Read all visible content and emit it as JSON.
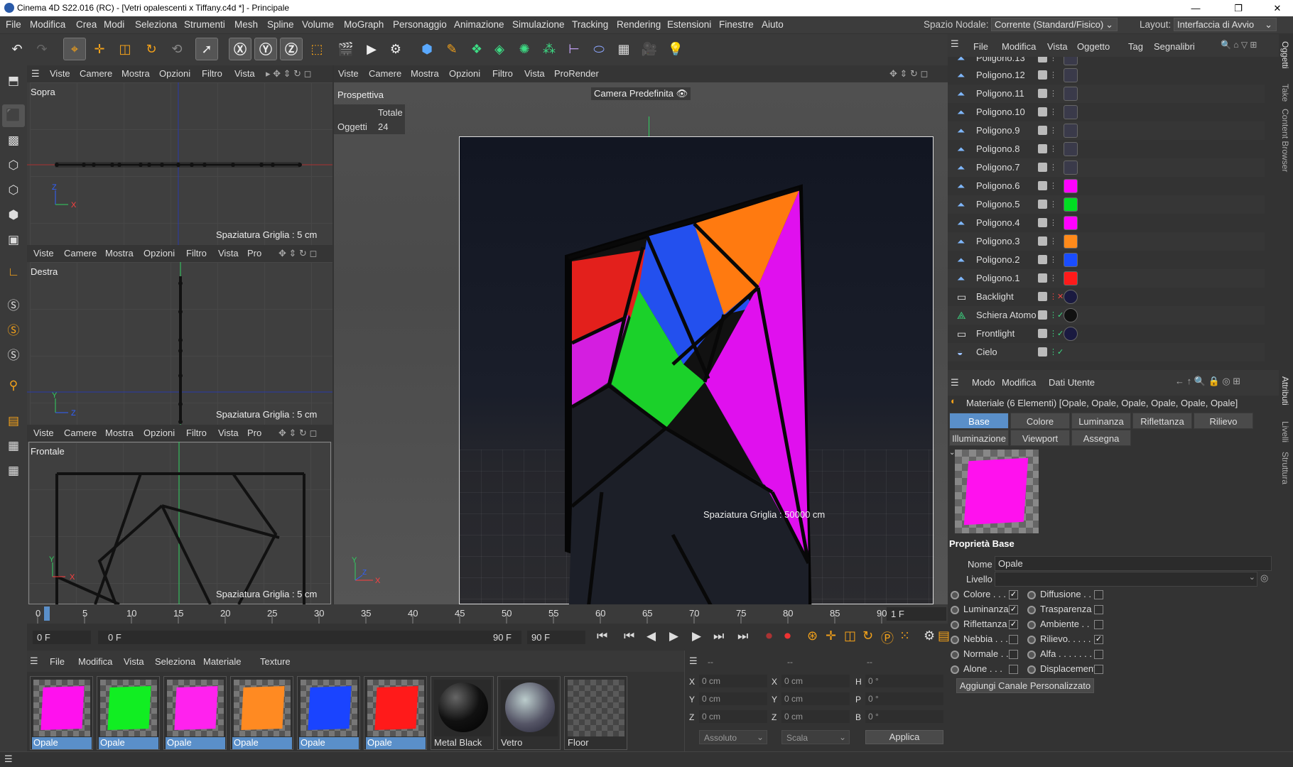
{
  "window": {
    "title": "Cinema 4D S22.016 (RC) - [Vetri opalescenti x Tiffany.c4d *] - Principale",
    "minimize": "—",
    "restore": "❐",
    "close": "✕"
  },
  "menu": [
    "File",
    "Modifica",
    "Crea",
    "Modi",
    "Seleziona",
    "Strumenti",
    "Mesh",
    "Spline",
    "Volume",
    "MoGraph",
    "Personaggio",
    "Animazione",
    "Simulazione",
    "Tracking",
    "Rendering",
    "Estensioni",
    "Finestre",
    "Aiuto"
  ],
  "spazio_nodale": {
    "label": "Spazio Nodale:",
    "value": "Corrente (Standard/Fisico)"
  },
  "layout": {
    "label": "Layout:",
    "value": "Interfaccia di Avvio"
  },
  "side_tabs": [
    "Oggetti",
    "Take",
    "Content Browser"
  ],
  "side_tabs2": [
    "Attributi",
    "Livelli",
    "Struttura"
  ],
  "viewport_menu": [
    "Viste",
    "Camere",
    "Mostra",
    "Opzioni",
    "Filtro",
    "Vista"
  ],
  "viewport_menu_short": [
    "Viste",
    "Camere",
    "Mostra",
    "Opzioni",
    "Filtro",
    "Vista",
    "Pro"
  ],
  "main_vp_menu": [
    "Viste",
    "Camere",
    "Mostra",
    "Opzioni",
    "Filtro",
    "Vista",
    "ProRender"
  ],
  "views": {
    "top": "Sopra",
    "right": "Destra",
    "front": "Frontale",
    "persp": "Prospettiva"
  },
  "grid_spacing": "Spaziatura Griglia : 5 cm",
  "grid_spacing_main": "Spaziatura Griglia : 50000 cm",
  "camera": "Camera Predefinita",
  "stats": {
    "header": "Totale",
    "label": "Oggetti",
    "value": "24"
  },
  "obj_menu": [
    "File",
    "Modifica",
    "Vista",
    "Oggetto",
    "Tag",
    "Segnalibri"
  ],
  "objects": [
    {
      "name": "Poligono.13",
      "tag": "#3a3a4a"
    },
    {
      "name": "Poligono.12",
      "tag": "#3a3a4a"
    },
    {
      "name": "Poligono.11",
      "tag": "#3a3a4a"
    },
    {
      "name": "Poligono.10",
      "tag": "#3a3a4a"
    },
    {
      "name": "Poligono.9",
      "tag": "#3a3a4a"
    },
    {
      "name": "Poligono.8",
      "tag": "#3a3a4a"
    },
    {
      "name": "Poligono.7",
      "tag": "#3a3a4a"
    },
    {
      "name": "Poligono.6",
      "tag": "#ff00ff"
    },
    {
      "name": "Poligono.5",
      "tag": "#00dd22"
    },
    {
      "name": "Poligono.4",
      "tag": "#ff00ff"
    },
    {
      "name": "Poligono.3",
      "tag": "#ff8a1a"
    },
    {
      "name": "Poligono.2",
      "tag": "#1a4dff"
    },
    {
      "name": "Poligono.1",
      "tag": "#ff1a1a"
    },
    {
      "name": "Backlight",
      "tag": "#1a1a40"
    },
    {
      "name": "Schiera Atomo",
      "tag": "#111111"
    },
    {
      "name": "Frontlight",
      "tag": "#1a1a40"
    },
    {
      "name": "Cielo",
      "tag": ""
    }
  ],
  "attr_menu": [
    "Modo",
    "Modifica",
    "Dati Utente"
  ],
  "attr_title": "Materiale (6 Elementi) [Opale, Opale, Opale, Opale, Opale, Opale]",
  "attr_tabs": [
    "Base",
    "Colore",
    "Luminanza",
    "Riflettanza",
    "Rilievo"
  ],
  "attr_tabs2": [
    "Illuminazione",
    "Viewport",
    "Assegna"
  ],
  "props_title": "Proprietà Base",
  "nome": {
    "label": "Nome",
    "value": "Opale"
  },
  "livello": {
    "label": "Livello",
    "value": ""
  },
  "channels_left": [
    {
      "label": "Colore . . .",
      "checked": true
    },
    {
      "label": "Luminanza",
      "checked": true
    },
    {
      "label": "Riflettanza",
      "checked": true
    },
    {
      "label": "Nebbia . . .",
      "checked": false
    },
    {
      "label": "Normale . .",
      "checked": false
    },
    {
      "label": "Alone . . .",
      "checked": false
    }
  ],
  "channels_right": [
    {
      "label": "Diffusione . .",
      "checked": false
    },
    {
      "label": "Trasparenza",
      "checked": false
    },
    {
      "label": "Ambiente . .",
      "checked": false
    },
    {
      "label": "Rilievo. . . . .",
      "checked": true
    },
    {
      "label": "Alfa . . . . . . .",
      "checked": false
    },
    {
      "label": "Displacement",
      "checked": false
    }
  ],
  "add_channel": "Aggiungi Canale Personalizzato",
  "timeline": {
    "ticks": [
      "0",
      "5",
      "10",
      "15",
      "20",
      "25",
      "30",
      "35",
      "40",
      "45",
      "50",
      "55",
      "60",
      "65",
      "70",
      "75",
      "80",
      "85",
      "90"
    ],
    "frame": "1 F",
    "start": "0 F",
    "cur": "0 F",
    "end1": "90 F",
    "end2": "90 F"
  },
  "mat_menu": [
    "File",
    "Modifica",
    "Vista",
    "Seleziona",
    "Materiale",
    "Texture"
  ],
  "materials": [
    {
      "name": "Opale",
      "color": "#ff11ee",
      "sel": true
    },
    {
      "name": "Opale",
      "color": "#11ee22",
      "sel": true
    },
    {
      "name": "Opale",
      "color": "#ff22ee",
      "sel": true
    },
    {
      "name": "Opale",
      "color": "#ff8a22",
      "sel": true
    },
    {
      "name": "Opale",
      "color": "#1a44ff",
      "sel": true
    },
    {
      "name": "Opale",
      "color": "#ff1a1a",
      "sel": true
    },
    {
      "name": "Metal Black",
      "color": "#111",
      "sel": false
    },
    {
      "name": "Vetro",
      "color": "#555a66",
      "sel": false
    },
    {
      "name": "Floor",
      "color": "",
      "sel": false
    }
  ],
  "coords": {
    "dashes": [
      "--",
      "--",
      "--"
    ],
    "rows": [
      [
        "X",
        "0 cm",
        "X",
        "0 cm",
        "H",
        "0 °"
      ],
      [
        "Y",
        "0 cm",
        "Y",
        "0 cm",
        "P",
        "0 °"
      ],
      [
        "Z",
        "0 cm",
        "Z",
        "0 cm",
        "B",
        "0 °"
      ]
    ],
    "mode": "Assoluto",
    "scale": "Scala",
    "apply": "Applica"
  }
}
